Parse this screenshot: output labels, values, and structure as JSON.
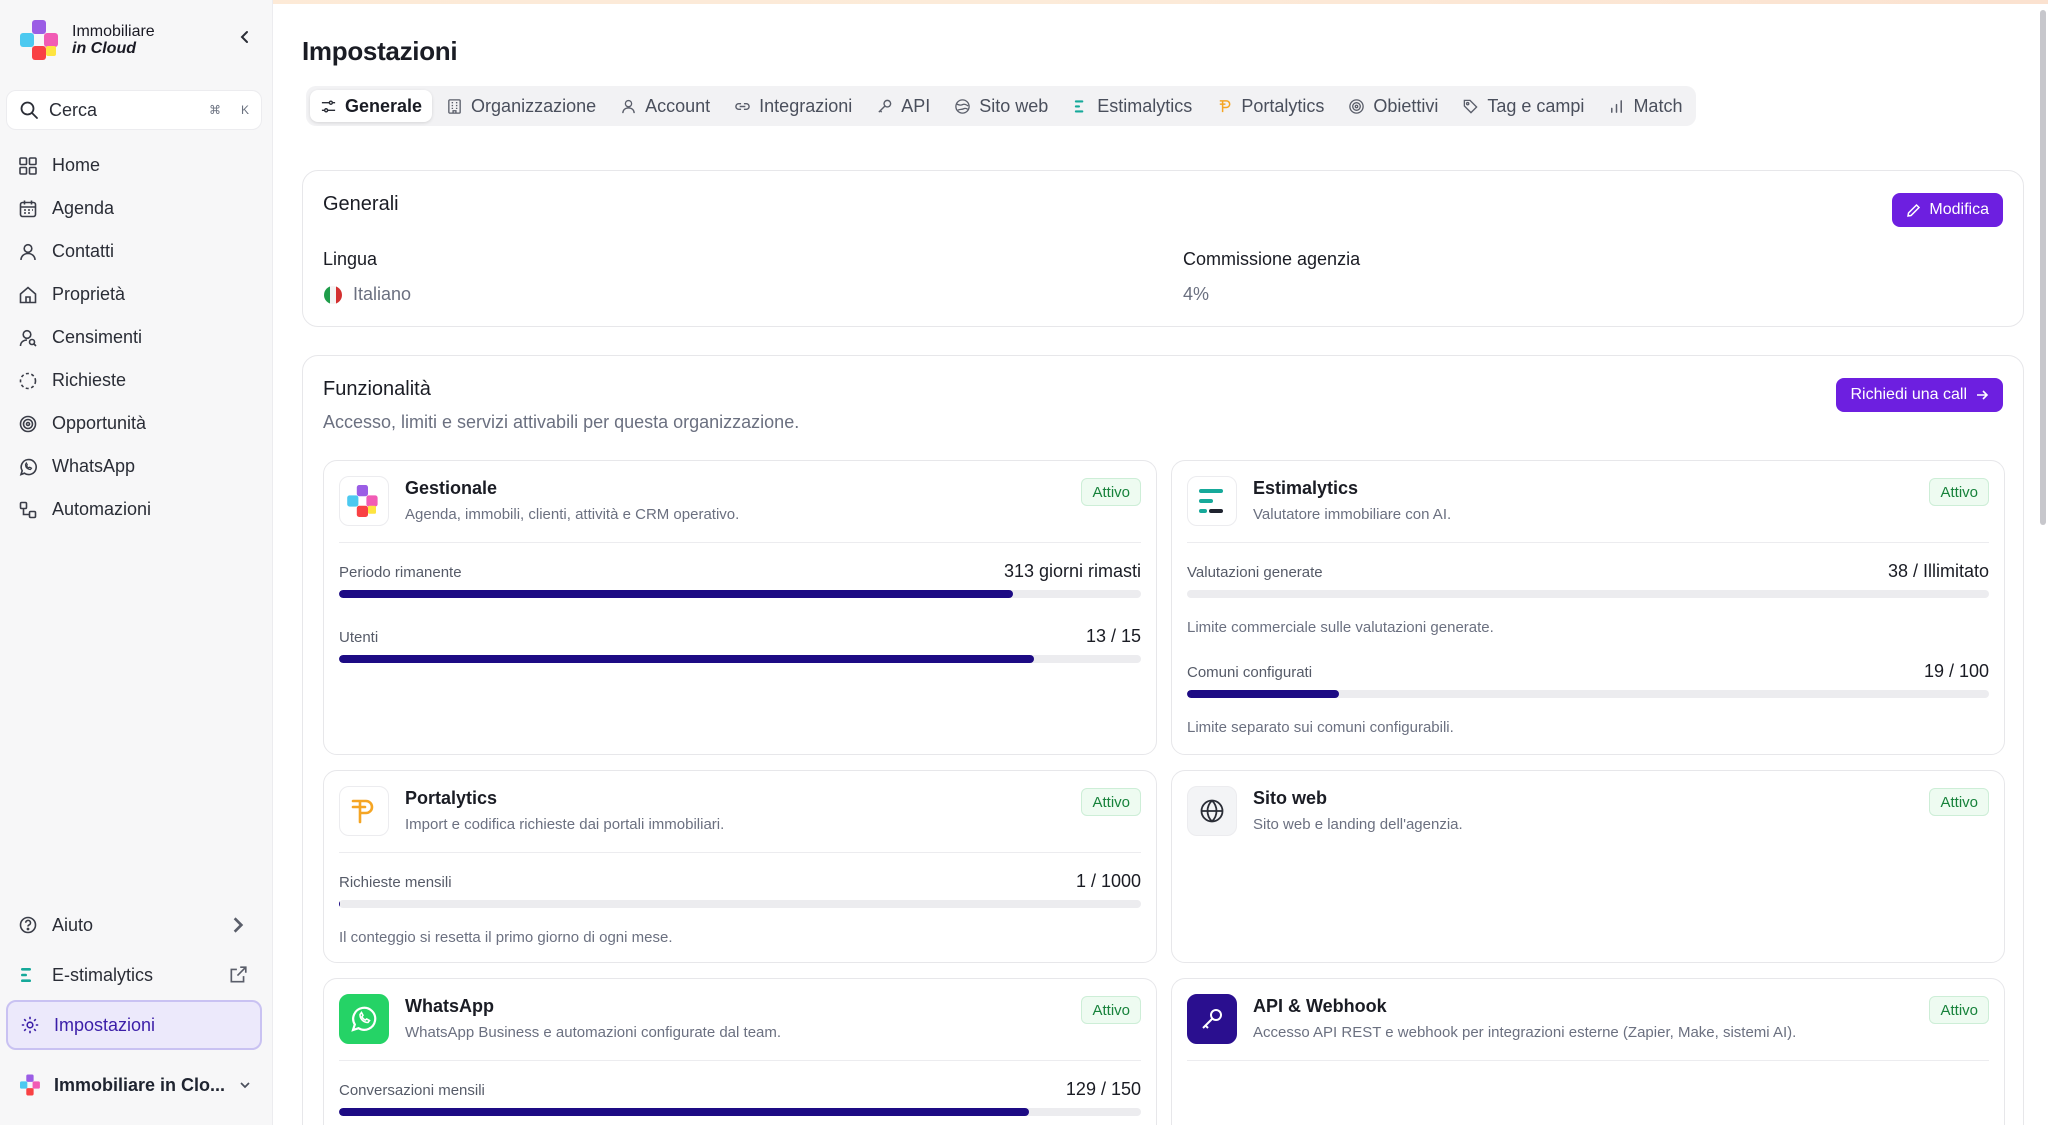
{
  "app": {
    "name_line1": "Immobiliare",
    "name_line2": "in Cloud"
  },
  "search": {
    "placeholder": "Cerca",
    "shortcut_cmd": "⌘",
    "shortcut_key": "K"
  },
  "sidebar": {
    "items": [
      {
        "label": "Home",
        "icon": "grid-icon"
      },
      {
        "label": "Agenda",
        "icon": "calendar-icon"
      },
      {
        "label": "Contatti",
        "icon": "user-icon"
      },
      {
        "label": "Proprietà",
        "icon": "house-icon"
      },
      {
        "label": "Censimenti",
        "icon": "user-search-icon"
      },
      {
        "label": "Richieste",
        "icon": "dashed-circle-icon"
      },
      {
        "label": "Opportunità",
        "icon": "target-icon"
      },
      {
        "label": "WhatsApp",
        "icon": "whatsapp-icon"
      },
      {
        "label": "Automazioni",
        "icon": "workflow-icon"
      }
    ],
    "bottom": {
      "help": "Aiuto",
      "estimalytics": "E-stimalytics",
      "settings": "Impostazioni"
    },
    "org_name": "Immobiliare in Clo..."
  },
  "page": {
    "title": "Impostazioni",
    "tabs": [
      {
        "label": "Generale",
        "active": true
      },
      {
        "label": "Organizzazione"
      },
      {
        "label": "Account"
      },
      {
        "label": "Integrazioni"
      },
      {
        "label": "API"
      },
      {
        "label": "Sito web"
      },
      {
        "label": "Estimalytics"
      },
      {
        "label": "Portalytics"
      },
      {
        "label": "Obiettivi"
      },
      {
        "label": "Tag e campi"
      },
      {
        "label": "Match"
      }
    ]
  },
  "generali": {
    "title": "Generali",
    "edit_label": "Modifica",
    "language_label": "Lingua",
    "language_value": "Italiano",
    "commission_label": "Commissione agenzia",
    "commission_value": "4%"
  },
  "funzionalita": {
    "title": "Funzionalità",
    "subtitle": "Accesso, limiti e servizi attivabili per questa organizzazione.",
    "call_label": "Richiedi una call",
    "features": [
      {
        "name": "Gestionale",
        "desc": "Agenda, immobili, clienti, attività e CRM operativo.",
        "status": "Attivo",
        "metrics": [
          {
            "label": "Periodo rimanente",
            "value": "313 giorni rimasti",
            "progress": 0.84
          },
          {
            "label": "Utenti",
            "value": "13 / 15",
            "progress": 0.867
          }
        ]
      },
      {
        "name": "Estimalytics",
        "desc": "Valutatore immobiliare con AI.",
        "status": "Attivo",
        "metrics": [
          {
            "label": "Valutazioni generate",
            "value": "38 / Illimitato",
            "progress": 0,
            "note": "Limite commerciale sulle valutazioni generate."
          },
          {
            "label": "Comuni configurati",
            "value": "19 / 100",
            "progress": 0.19,
            "note": "Limite separato sui comuni configurabili."
          }
        ]
      },
      {
        "name": "Portalytics",
        "desc": "Import e codifica richieste dai portali immobiliari.",
        "status": "Attivo",
        "metrics": [
          {
            "label": "Richieste mensili",
            "value": "1 / 1000",
            "progress": 0.001,
            "note": "Il conteggio si resetta il primo giorno di ogni mese."
          }
        ]
      },
      {
        "name": "Sito web",
        "desc": "Sito web e landing dell'agenzia.",
        "status": "Attivo",
        "metrics": []
      },
      {
        "name": "WhatsApp",
        "desc": "WhatsApp Business e automazioni configurate dal team.",
        "status": "Attivo",
        "metrics": [
          {
            "label": "Conversazioni mensili",
            "value": "129 / 150",
            "progress": 0.86
          }
        ]
      },
      {
        "name": "API & Webhook",
        "desc": "Accesso API REST e webhook per integrazioni esterne (Zapier, Make, sistemi AI).",
        "status": "Attivo",
        "metrics": []
      }
    ]
  },
  "colors": {
    "accent": "#6d1fe0",
    "progress": "#1d0b84",
    "active_badge": "#17823b",
    "whatsapp": "#25d366",
    "api": "#2a0f8f"
  }
}
